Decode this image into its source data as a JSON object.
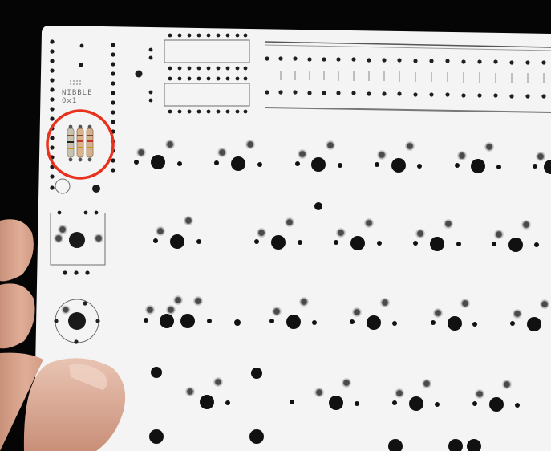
{
  "scene": {
    "subject": "keyboard-pcb",
    "board_color": "#f4f4f4",
    "background_color": "#050505",
    "highlight_color": "#e8321e"
  },
  "silkscreen": {
    "board_name": "NIBBLE",
    "board_version": "0x1"
  }
}
